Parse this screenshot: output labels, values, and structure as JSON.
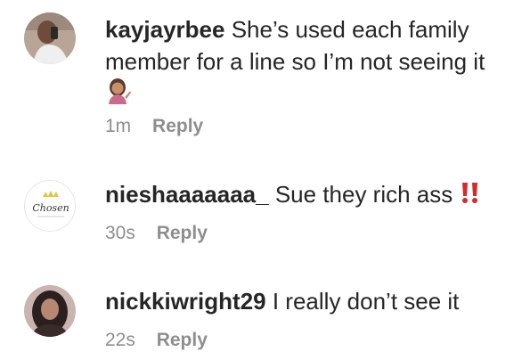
{
  "comments": [
    {
      "username": "kayjayrbee",
      "text_line1": "She’s used each family",
      "text_line2": "member for a line so I’m not seeing it",
      "emoji": "woman-tipping-hand-emoji",
      "time": "1m",
      "reply_label": "Reply"
    },
    {
      "username": "nieshaaaaaaa_",
      "text": "Sue they rich ass",
      "emoji": "double-exclamation-mark-emoji",
      "avatar_text": "Chosen",
      "time": "30s",
      "reply_label": "Reply"
    },
    {
      "username": "nickkiwright29",
      "text": "I really don’t see it",
      "time": "22s",
      "reply_label": "Reply"
    }
  ],
  "colors": {
    "text": "#262626",
    "meta": "#8e8e8e",
    "emoji_red": "#d42a2a"
  }
}
